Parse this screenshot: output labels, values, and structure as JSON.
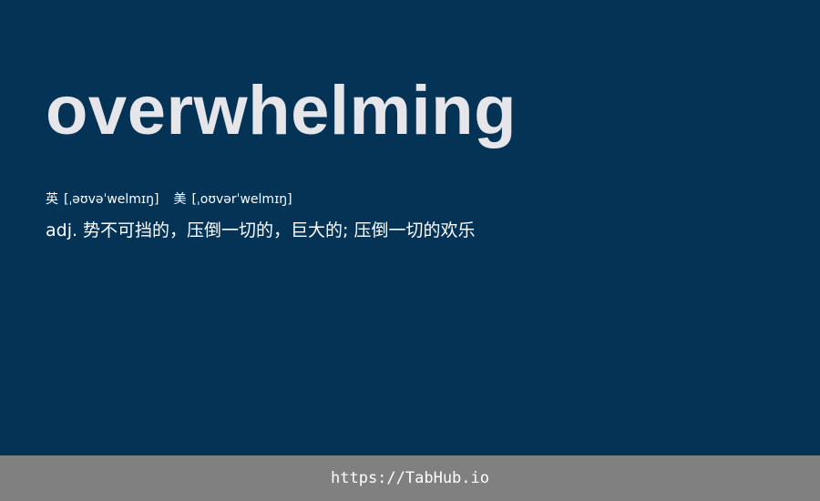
{
  "word": "overwhelming",
  "phonetics": {
    "uk_label": "英",
    "uk": "[ˌəʊvəˈwelmɪŋ]",
    "us_label": "美",
    "us": "[ˌoʊvərˈwelmɪŋ]"
  },
  "definition": "adj. 势不可挡的，压倒一切的，巨大的; 压倒一切的欢乐",
  "footer": {
    "link": "https://TabHub.io"
  },
  "colors": {
    "background": "#043356",
    "footer_bg": "#808080",
    "word": "#e6e6ea"
  }
}
